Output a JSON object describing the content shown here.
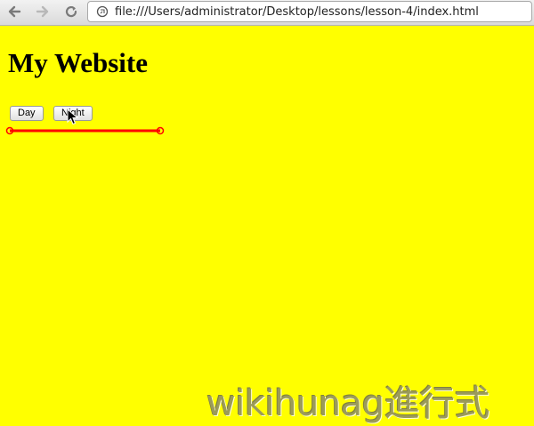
{
  "browser": {
    "url": "file:///Users/administrator/Desktop/lessons/lesson-4/index.html"
  },
  "page": {
    "title": "My Website",
    "buttons": {
      "day_label": "Day",
      "night_label": "Night"
    },
    "background_color": "#ffff00",
    "line_color": "#ff0000"
  },
  "watermark": {
    "text": "wikihunag進行式"
  },
  "icons": {
    "back": "back-arrow-icon",
    "forward": "forward-arrow-icon",
    "reload": "reload-icon",
    "page": "page-icon",
    "cursor": "mouse-pointer-icon"
  }
}
